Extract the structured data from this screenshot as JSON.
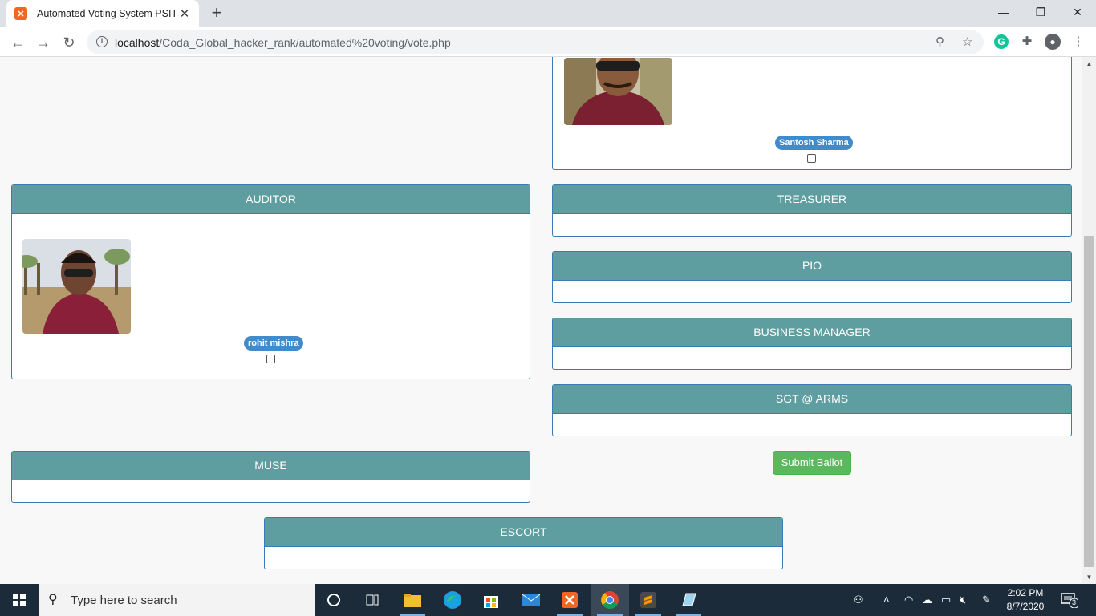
{
  "browser": {
    "tab_title": "Automated Voting System PSITS",
    "url_host": "localhost",
    "url_path": "/Coda_Global_hacker_rank/automated%20voting/vote.php"
  },
  "ballot": {
    "top_candidate": {
      "name": "Santosh Sharma"
    },
    "positions": {
      "auditor": {
        "title": "AUDITOR",
        "candidate_name": "rohit mishra"
      },
      "treasurer": {
        "title": "TREASURER"
      },
      "pio": {
        "title": "PIO"
      },
      "business_manager": {
        "title": "BUSINESS MANAGER"
      },
      "sgt_arms": {
        "title": "SGT @ ARMS"
      },
      "muse": {
        "title": "MUSE"
      },
      "escort": {
        "title": "ESCORT"
      }
    },
    "submit_label": "Submit Ballot"
  },
  "taskbar": {
    "search_placeholder": "Type here to search",
    "time": "2:02 PM",
    "date": "8/7/2020",
    "notification_count": "3"
  },
  "colors": {
    "panel_heading": "#5f9ea0",
    "panel_border": "#3a7ab7",
    "name_badge": "#428bca",
    "submit_button": "#5cb85c",
    "taskbar": "#1c2b3a"
  }
}
